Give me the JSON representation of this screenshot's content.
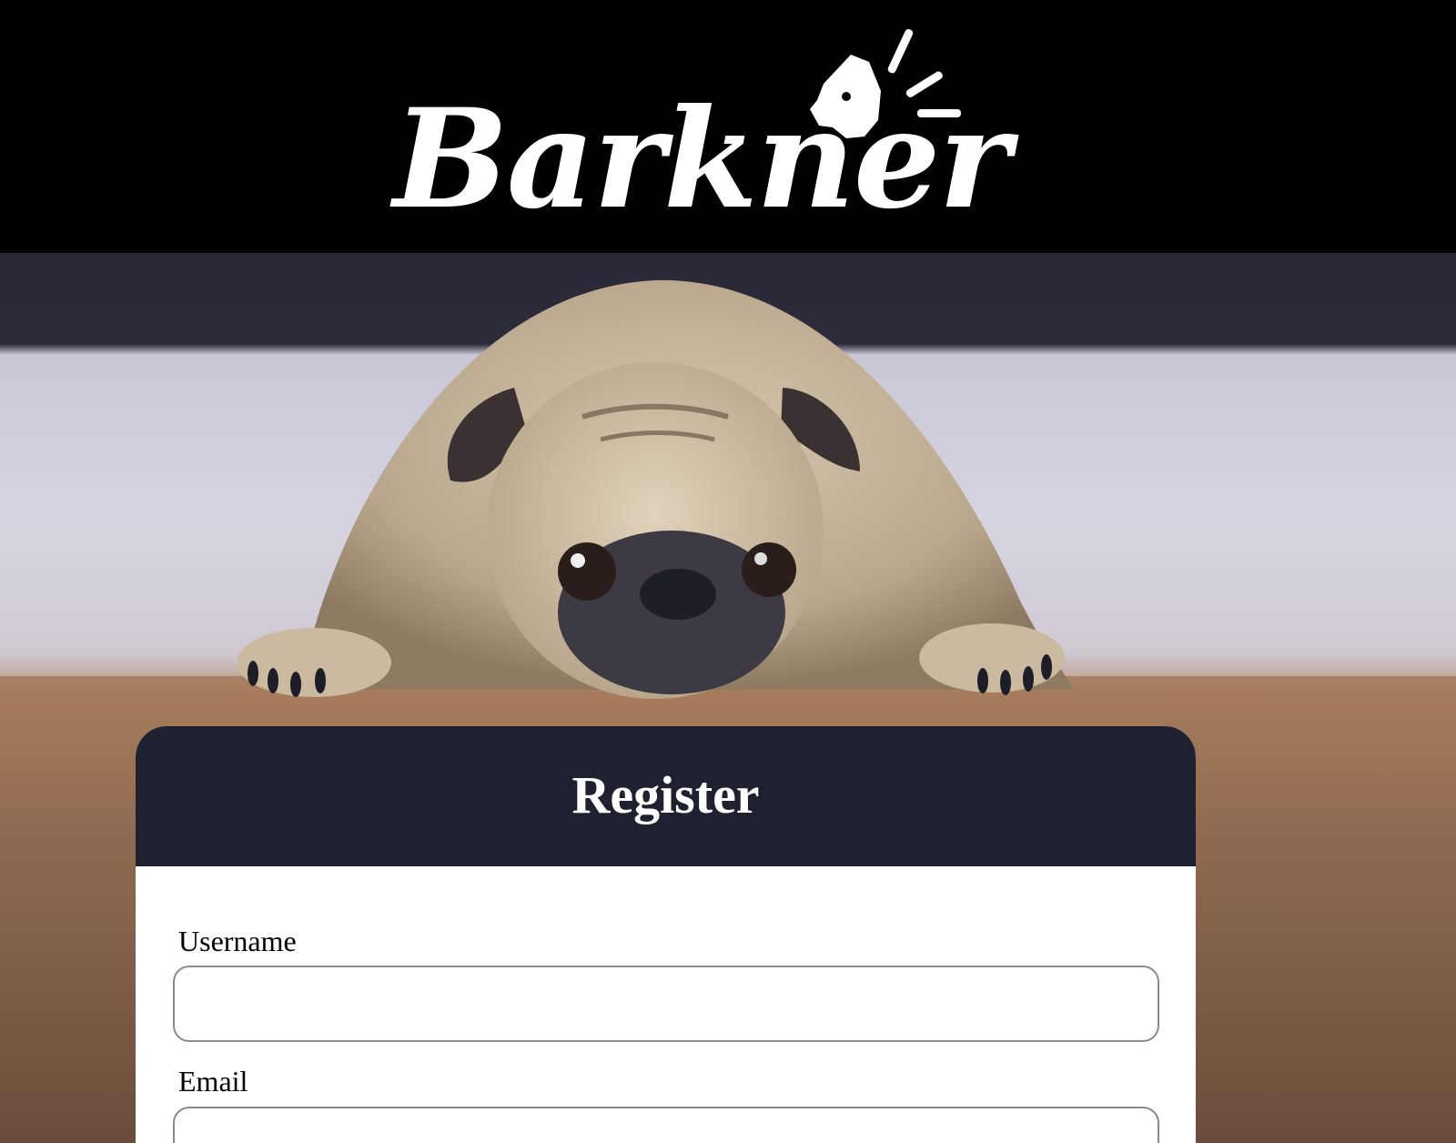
{
  "brand": {
    "logo_text": "Barkner",
    "logo_icon": "barking-dog-head-icon"
  },
  "hero": {
    "image": "pug-lying-on-floor"
  },
  "register": {
    "title": "Register",
    "fields": [
      {
        "label": "Username",
        "value": "",
        "placeholder": ""
      },
      {
        "label": "Email",
        "value": "",
        "placeholder": ""
      }
    ]
  },
  "colors": {
    "header_bg": "#000000",
    "card_header_bg": "#1f2130",
    "card_body_bg": "#ffffff"
  }
}
